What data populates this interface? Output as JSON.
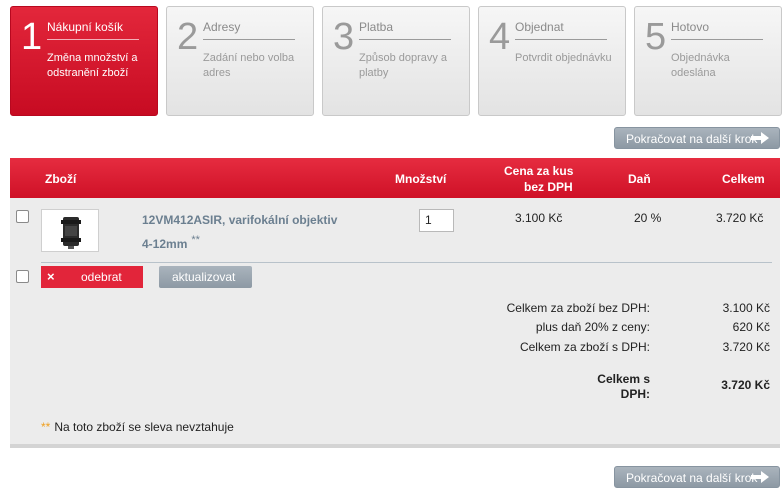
{
  "steps": [
    {
      "num": "1",
      "title": "Nákupní košík",
      "desc": "Změna množství a odstranění zboží",
      "active": true
    },
    {
      "num": "2",
      "title": "Adresy",
      "desc": "Zadání nebo volba adres",
      "active": false
    },
    {
      "num": "3",
      "title": "Platba",
      "desc": "Způsob dopravy a platby",
      "active": false
    },
    {
      "num": "4",
      "title": "Objednat",
      "desc": "Potvrdit objednávku",
      "active": false
    },
    {
      "num": "5",
      "title": "Hotovo",
      "desc": "Objednávka odeslána",
      "active": false
    }
  ],
  "continue_label": "Pokračovat na další krok",
  "table": {
    "headers": {
      "product": "Zboží",
      "quantity": "Množství",
      "unit_price_line1": "Cena za kus",
      "unit_price_line2": "bez DPH",
      "tax": "Daň",
      "total": "Celkem"
    },
    "row": {
      "name_line1": "12VM412ASIR, varifokální objektiv",
      "name_line2": "4-12mm",
      "name_marker": "**",
      "quantity": "1",
      "unit_price": "3.100 Kč",
      "tax": "20 %",
      "total": "3.720 Kč"
    }
  },
  "actions": {
    "remove_icon": "×",
    "remove_label": "odebrat",
    "update_label": "aktualizovat"
  },
  "summary": {
    "subtotal_label": "Celkem za zboží bez DPH:",
    "subtotal_value": "3.100 Kč",
    "tax_label": "plus daň 20% z ceny:",
    "tax_value": "620 Kč",
    "total_with_tax_label": "Celkem za zboží s DPH:",
    "total_with_tax_value": "3.720 Kč",
    "grand_total_label": "Celkem s DPH:",
    "grand_total_value": "3.720 Kč"
  },
  "note": {
    "marker": "**",
    "text": "Na toto zboží se sleva nevztahuje"
  },
  "colors": {
    "accent_red": "#d9182e",
    "button_gray": "#9aa5af",
    "link_blue_gray": "#6b7f90",
    "note_marker": "#f0a020"
  }
}
